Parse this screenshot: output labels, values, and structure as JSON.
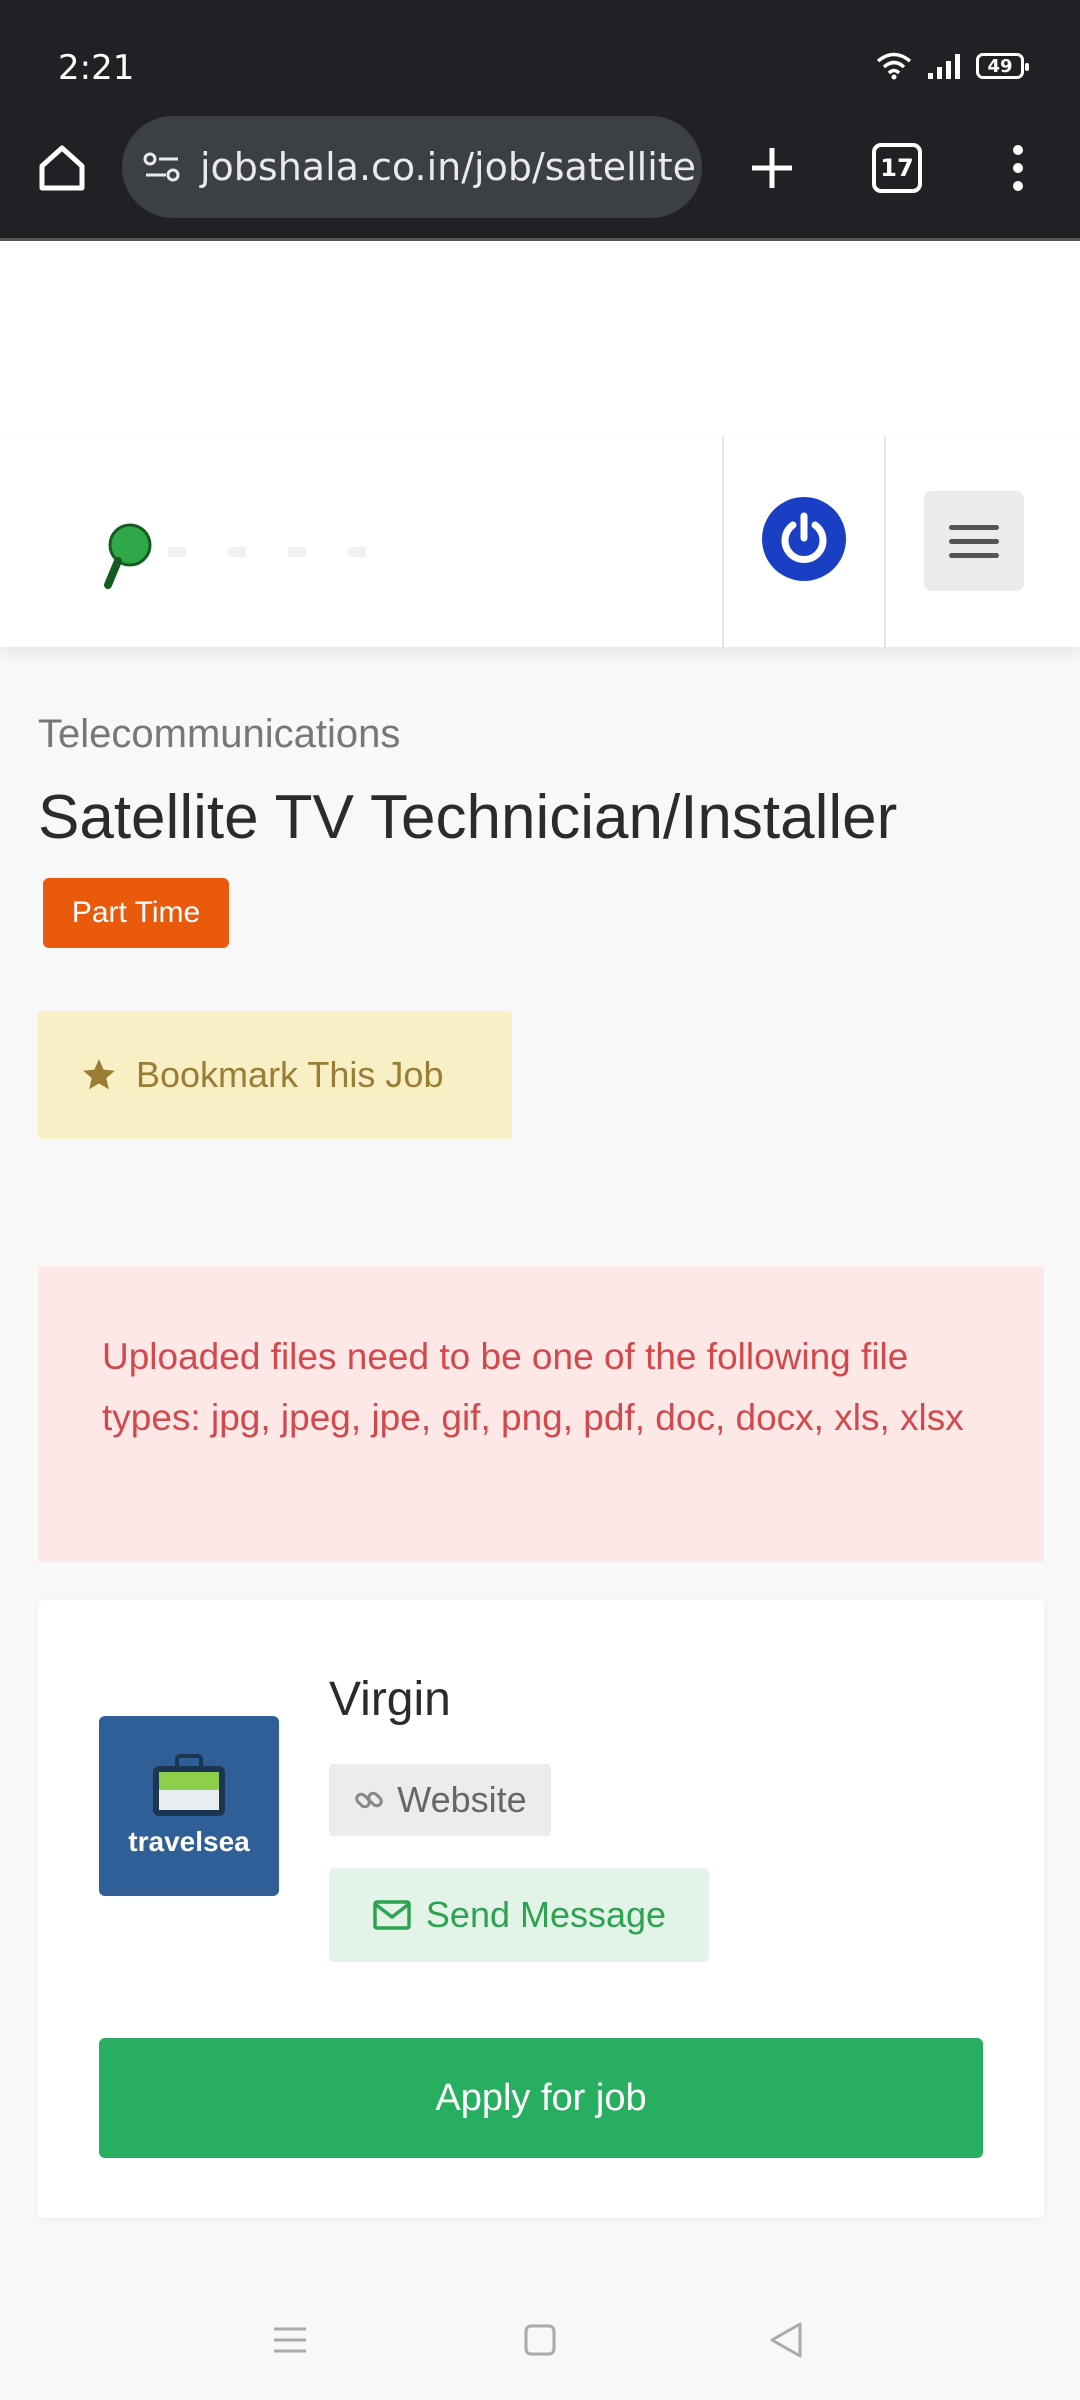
{
  "status_bar": {
    "time": "2:21",
    "battery": "49"
  },
  "browser": {
    "url": "jobshala.co.in/job/satellite",
    "tab_count": "17"
  },
  "job": {
    "category": "Telecommunications",
    "title": "Satellite TV Technician/Installer",
    "type_badge": "Part Time",
    "bookmark_label": "Bookmark This Job"
  },
  "alert": {
    "message": "Uploaded files need to be one of the following file types: jpg, jpeg, jpe, gif, png, pdf, doc, docx, xls, xlsx"
  },
  "company": {
    "name": "Virgin",
    "logo_text": "travelsea",
    "website_label": "Website",
    "message_label": "Send Message",
    "apply_label": "Apply for job"
  },
  "colors": {
    "badge": "#ea5a0c",
    "apply": "#27ae60",
    "alert_bg": "#fde7e7",
    "bookmark_bg": "#f9efc4",
    "login": "#1a3fc4"
  }
}
